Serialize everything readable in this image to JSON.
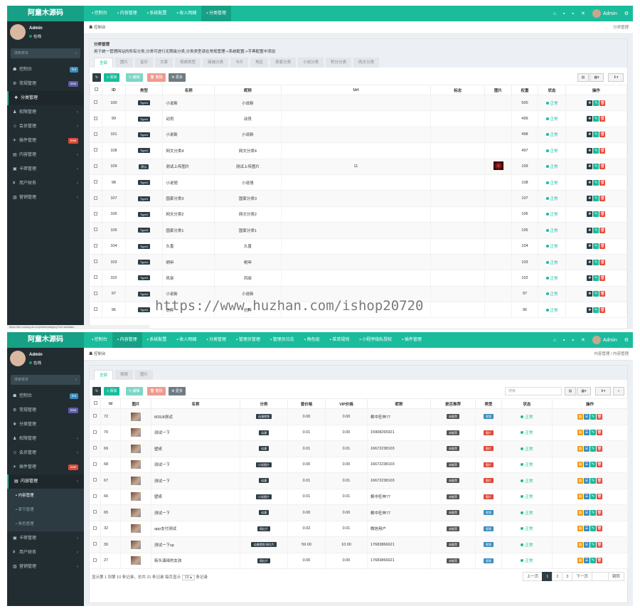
{
  "app": {
    "logo": "阿童木源码",
    "user": "Admin",
    "status": "在线",
    "search_placeholder": "搜索菜单"
  },
  "panel1": {
    "topnav": [
      "控制台",
      "内容管理",
      "系统配置",
      "收入明细",
      "分类管理"
    ],
    "sidebar": [
      {
        "label": "控制台",
        "badge": "hot",
        "badge_color": "#3c8dbc"
      },
      {
        "label": "常规管理",
        "badge": "new",
        "badge_color": "#605ca8"
      },
      {
        "label": "分类管理",
        "active": true
      },
      {
        "label": "权限管理",
        "chevron": true
      },
      {
        "label": "会员管理",
        "chevron": true
      },
      {
        "label": "插件管理",
        "badge": "new",
        "badge_color": "#dd4b39"
      },
      {
        "label": "内容管理",
        "chevron": true
      },
      {
        "label": "卡密管理",
        "chevron": true
      },
      {
        "label": "用户财务",
        "chevron": true
      },
      {
        "label": "营销管理",
        "chevron": true
      }
    ],
    "breadcrumb": "控制台",
    "breadcrumb_right": "分类管理",
    "desc_title": "分类管理",
    "desc_text": "用于统一管理网站的所有分类,分类可进行无限级分类,分类类型请在常规管理->系统配置->字典配置中添加",
    "tabs": [
      "全部",
      "图片",
      "音乐",
      "文章",
      "视频类型",
      "商城分类",
      "卡片",
      "地区",
      "卖家分类",
      "小说分类",
      "积分分类",
      "网文分类"
    ],
    "buttons": {
      "refresh": "↻",
      "add": "+ 添加",
      "edit": "✎ 编辑",
      "delete": "🗑 删除",
      "more": "⚙ 更多"
    },
    "columns": [
      "",
      "ID",
      "类型",
      "名称",
      "昵称",
      "Url",
      "标志",
      "图片",
      "权重",
      "状态",
      "操作"
    ],
    "rows": [
      {
        "id": "100",
        "type": "Type4",
        "name": "小说新",
        "nick": "小说新",
        "url": "",
        "img": false,
        "weight": "500",
        "status": "正常"
      },
      {
        "id": "99",
        "type": "Type4",
        "name": "动员",
        "nick": "动员",
        "url": "",
        "img": false,
        "weight": "499",
        "status": "正常"
      },
      {
        "id": "101",
        "type": "Type4",
        "name": "小说新",
        "nick": "小说新",
        "url": "",
        "img": false,
        "weight": "498",
        "status": "正常"
      },
      {
        "id": "108",
        "type": "Type4",
        "name": "网文分类4",
        "nick": "网文分类4",
        "url": "",
        "img": false,
        "weight": "497",
        "status": "正常"
      },
      {
        "id": "109",
        "type": "默认",
        "name": "测试上传图片",
        "nick": "测试上传图片",
        "url": "11",
        "img": true,
        "weight": "109",
        "status": "正常"
      },
      {
        "id": "98",
        "type": "Type4",
        "name": "小说旭",
        "nick": "小说旭",
        "url": "",
        "img": false,
        "weight": "108",
        "status": "正常"
      },
      {
        "id": "107",
        "type": "Type3",
        "name": "国家分类3",
        "nick": "国家分类3",
        "url": "",
        "img": false,
        "weight": "107",
        "status": "正常"
      },
      {
        "id": "106",
        "type": "Type4",
        "name": "网文分类2",
        "nick": "网文分类2",
        "url": "",
        "img": false,
        "weight": "106",
        "status": "正常"
      },
      {
        "id": "105",
        "type": "Type3",
        "name": "国家分类1",
        "nick": "国家分类1",
        "url": "",
        "img": false,
        "weight": "105",
        "status": "正常"
      },
      {
        "id": "104",
        "type": "Type4",
        "name": "久香",
        "nick": "久香",
        "url": "",
        "img": false,
        "weight": "104",
        "status": "正常"
      },
      {
        "id": "103",
        "type": "Type4",
        "name": "明甲",
        "nick": "明甲",
        "url": "",
        "img": false,
        "weight": "103",
        "status": "正常"
      },
      {
        "id": "102",
        "type": "Type4",
        "name": "风柒",
        "nick": "风柒",
        "url": "",
        "img": false,
        "weight": "102",
        "status": "正常"
      },
      {
        "id": "97",
        "type": "Type4",
        "name": "小说新",
        "nick": "小说新",
        "url": "",
        "img": false,
        "weight": "97",
        "status": "正常"
      },
      {
        "id": "96",
        "type": "Type4",
        "name": "仿粹",
        "nick": "仿粹",
        "url": "",
        "img": false,
        "weight": "96",
        "status": "正常"
      }
    ],
    "status_url": "https://ttu.xnvhuy.xh.cc/ybhot/category?ref=addtabs"
  },
  "watermark": "https://www.huzhan.com/ishop20720",
  "panel2": {
    "topnav": [
      "控制台",
      "内容管理",
      "系统配置",
      "收入明细",
      "分类管理",
      "管理员管理",
      "管理员日志",
      "角色组",
      "菜单规则",
      "小程序隐私授权",
      "插件管理"
    ],
    "sidebar": [
      {
        "label": "控制台",
        "badge": "hot",
        "badge_color": "#3c8dbc"
      },
      {
        "label": "常规管理",
        "badge": "new",
        "badge_color": "#605ca8"
      },
      {
        "label": "分类管理"
      },
      {
        "label": "权限管理",
        "chevron": true
      },
      {
        "label": "会员管理",
        "chevron": true
      },
      {
        "label": "插件管理",
        "badge": "new",
        "badge_color": "#dd4b39"
      },
      {
        "label": "内容管理",
        "active": true,
        "chevron": true
      }
    ],
    "subitems": [
      {
        "label": "内容管理",
        "active": true
      },
      {
        "label": "章节管理"
      },
      {
        "label": "角色管理"
      }
    ],
    "sidebar2": [
      {
        "label": "卡密管理",
        "chevron": true
      },
      {
        "label": "用户财务",
        "chevron": true
      },
      {
        "label": "营销管理",
        "chevron": true
      }
    ],
    "breadcrumb": "控制台",
    "breadcrumb_right": "内容管理 / 内容管理",
    "tabs": [
      "全部",
      "视频",
      "图片"
    ],
    "buttons": {
      "refresh": "↻",
      "add": "+ 添加",
      "edit": "✎ 编辑",
      "delete": "🗑 删除",
      "more": "⚙ 更多"
    },
    "search_placeholder": "搜索",
    "columns": [
      "",
      "Id",
      "图片",
      "名称",
      "分类",
      "普价格",
      "VIP价格",
      "昵称",
      "是否推荐",
      "类型",
      "状态",
      "操作"
    ],
    "rows": [
      {
        "id": "72",
        "name": "M3U8测试",
        "cat": "动漫视频",
        "price": "0.00",
        "vip": "0.00",
        "nick": "枫中狂奔77",
        "rec": "未推荐",
        "type": "视频",
        "type_color": "#3c8dbc",
        "status": "正常"
      },
      {
        "id": "70",
        "name": "测试一下",
        "cat": "动漫",
        "price": "0.01",
        "vip": "0.00",
        "nick": "15908265921",
        "rec": "未推荐",
        "type": "图片",
        "type_color": "#dd4b39",
        "status": "正常"
      },
      {
        "id": "69",
        "name": "壁纸",
        "cat": "动漫",
        "price": "0.01",
        "vip": "0.01",
        "nick": "16672238103",
        "rec": "未推荐",
        "type": "图片",
        "type_color": "#dd4b39",
        "status": "正常"
      },
      {
        "id": "68",
        "name": "测试一下",
        "cat": "小说图片",
        "price": "0.00",
        "vip": "0.00",
        "nick": "16672238103",
        "rec": "未推荐",
        "type": "图片",
        "type_color": "#dd4b39",
        "status": "正常"
      },
      {
        "id": "67",
        "name": "测试一下",
        "cat": "动漫",
        "price": "0.01",
        "vip": "0.01",
        "nick": "16672238103",
        "rec": "未推荐",
        "type": "图片",
        "type_color": "#dd4b39",
        "status": "正常"
      },
      {
        "id": "66",
        "name": "壁纸",
        "cat": "小说图片",
        "price": "0.01",
        "vip": "0.01",
        "nick": "枫中狂奔77",
        "rec": "未推荐",
        "type": "图片",
        "type_color": "#dd4b39",
        "status": "正常"
      },
      {
        "id": "65",
        "name": "测试一下",
        "cat": "动漫",
        "price": "0.00",
        "vip": "0.00",
        "nick": "枫中狂奔77",
        "rec": "未推荐",
        "type": "视频",
        "type_color": "#3c8dbc",
        "status": "正常"
      },
      {
        "id": "32",
        "name": "app支付测试",
        "cat": "网红片",
        "price": "0.02",
        "vip": "0.01",
        "nick": "微信用户",
        "rec": "未推荐",
        "type": "视频",
        "type_color": "#3c8dbc",
        "status": "正常"
      },
      {
        "id": "30",
        "name": "测试一下sp",
        "cat": "动漫视频 网红片",
        "price": "59.00",
        "vip": "10.00",
        "nick": "17683866621",
        "rec": "未推荐",
        "type": "视频",
        "type_color": "#3c8dbc",
        "status": "正常"
      },
      {
        "id": "27",
        "name": "街头演绎的女孩",
        "cat": "网红片",
        "price": "0.00",
        "vip": "0.00",
        "nick": "17683866621",
        "rec": "未推荐",
        "type": "视频",
        "type_color": "#3c8dbc",
        "status": "正常"
      }
    ],
    "footer_text": "显示第 1 到第 10 条记录，总共 21 条记录 每页显示",
    "page_size": "10 ▴",
    "footer_suffix": "条记录",
    "pager": [
      "上一页",
      "1",
      "2",
      "3",
      "下一页",
      "",
      "跳转"
    ]
  }
}
